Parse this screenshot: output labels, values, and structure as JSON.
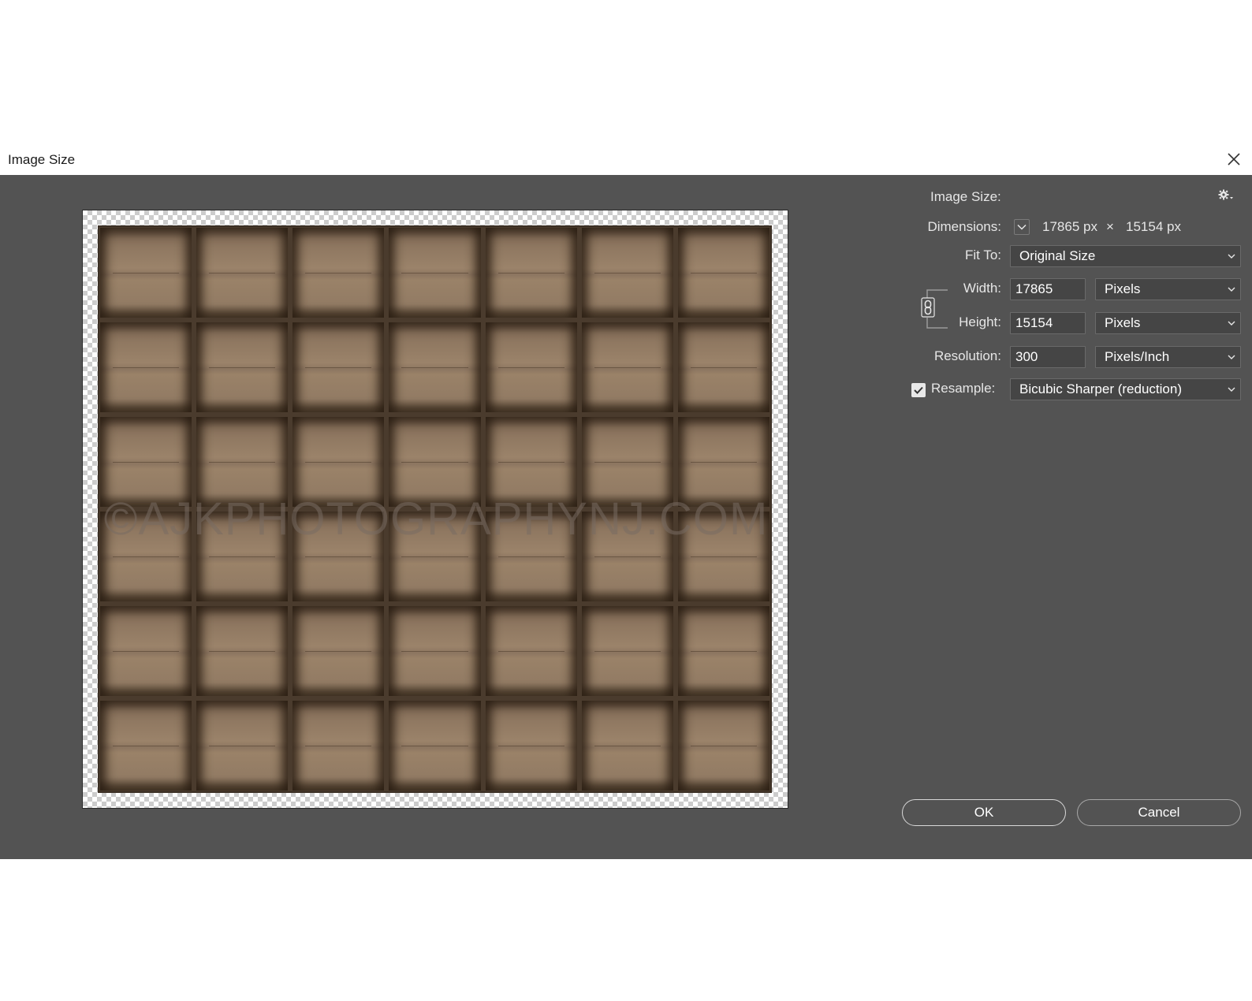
{
  "dialog": {
    "title": "Image Size",
    "close_icon": "close-icon"
  },
  "preview": {
    "watermark": "©AJKPHOTOGRAPHYNJ.COM",
    "grid": {
      "columns": 7,
      "rows": 6
    }
  },
  "panel": {
    "image_size_label": "Image Size:",
    "gear_icon": "gear-icon",
    "dimensions": {
      "label": "Dimensions:",
      "toggle_icon": "chevron-down-icon",
      "width_value": "17865 px",
      "times": "×",
      "height_value": "15154 px"
    },
    "fit_to": {
      "label": "Fit To:",
      "value": "Original Size"
    },
    "width": {
      "label": "Width:",
      "value": "17865",
      "unit": "Pixels"
    },
    "height": {
      "label": "Height:",
      "value": "15154",
      "unit": "Pixels"
    },
    "constrain_icon": "link-icon",
    "resolution": {
      "label": "Resolution:",
      "value": "300",
      "unit": "Pixels/Inch"
    },
    "resample": {
      "label": "Resample:",
      "checked": true,
      "value": "Bicubic Sharper (reduction)"
    }
  },
  "buttons": {
    "ok": "OK",
    "cancel": "Cancel"
  },
  "colors": {
    "panel_bg": "#535353",
    "field_bg": "#454545",
    "text": "#e6e6e6"
  }
}
